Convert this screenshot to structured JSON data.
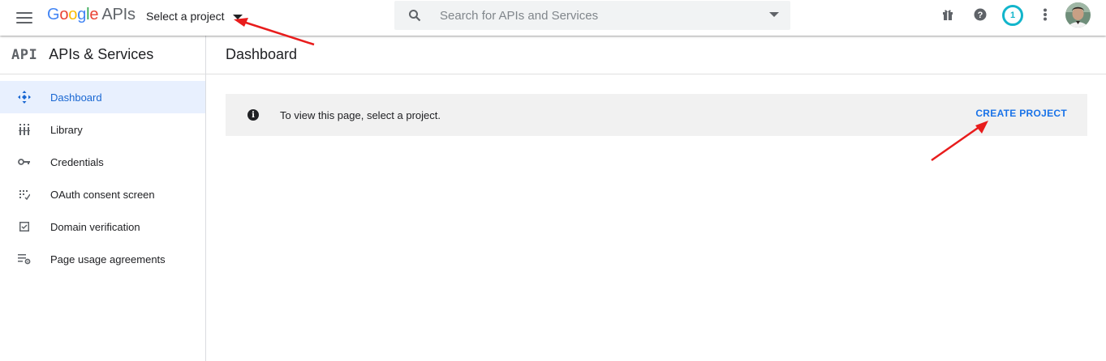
{
  "header": {
    "logo_google": [
      "G",
      "o",
      "o",
      "g",
      "l",
      "e"
    ],
    "logo_apis": "APIs",
    "project_picker_label": "Select a project",
    "search_placeholder": "Search for APIs and Services",
    "notification_count": "1",
    "icons": [
      "menu-icon",
      "search-icon",
      "gift-icon",
      "help-icon",
      "more-vert-icon",
      "avatar"
    ]
  },
  "sidebar": {
    "badge": "API",
    "title": "APIs & Services",
    "items": [
      {
        "label": "Dashboard",
        "icon": "dashboard-icon",
        "active": true
      },
      {
        "label": "Library",
        "icon": "library-icon",
        "active": false
      },
      {
        "label": "Credentials",
        "icon": "key-icon",
        "active": false
      },
      {
        "label": "OAuth consent screen",
        "icon": "consent-icon",
        "active": false
      },
      {
        "label": "Domain verification",
        "icon": "checkbox-icon",
        "active": false
      },
      {
        "label": "Page usage agreements",
        "icon": "settings-list-icon",
        "active": false
      }
    ]
  },
  "main": {
    "title": "Dashboard",
    "banner": {
      "message": "To view this page, select a project.",
      "action": "CREATE PROJECT"
    }
  },
  "colors": {
    "accent": "#1a73e8",
    "active_bg": "#e8f0fe",
    "banner_bg": "#f1f1f1",
    "notification": "#12b5cb",
    "annotation_arrow": "#e81c1c"
  }
}
